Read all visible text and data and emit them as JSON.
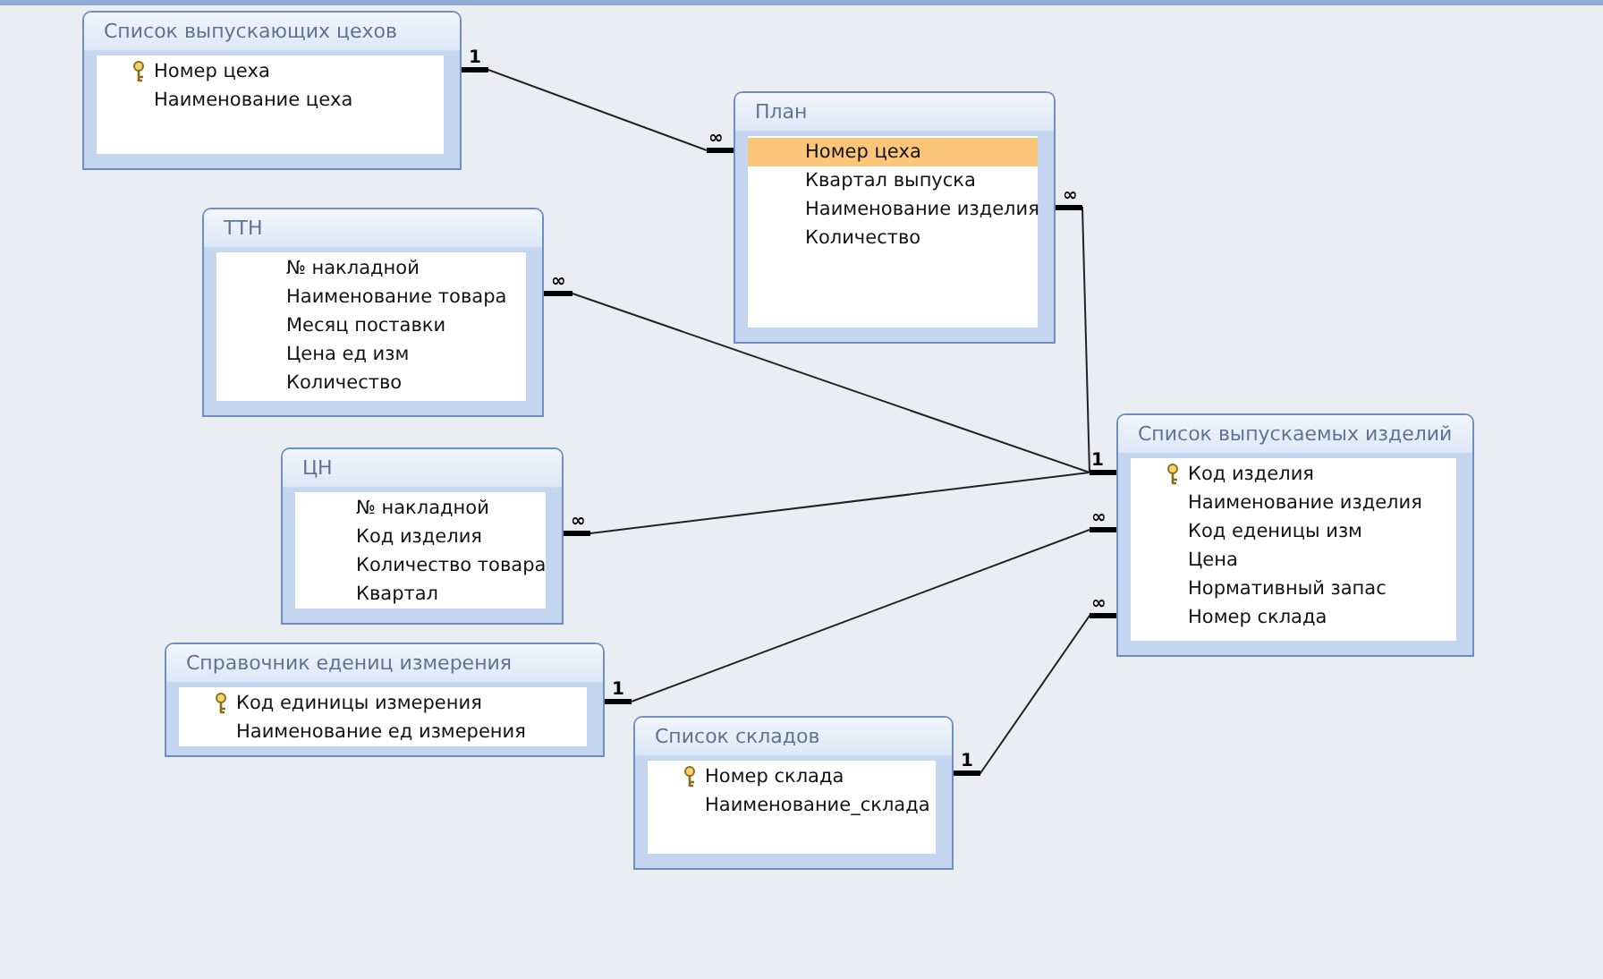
{
  "tables": [
    {
      "title": "Список выпускающих цехов",
      "fields": [
        {
          "name": "Номер цеха",
          "key": true,
          "selected": false
        },
        {
          "name": "Наименование цеха",
          "key": false,
          "selected": false
        }
      ]
    },
    {
      "title": "План",
      "fields": [
        {
          "name": "Номер цеха",
          "key": false,
          "selected": true
        },
        {
          "name": "Квартал выпуска",
          "key": false,
          "selected": false
        },
        {
          "name": "Наименование изделия",
          "key": false,
          "selected": false
        },
        {
          "name": "Количество",
          "key": false,
          "selected": false
        }
      ]
    },
    {
      "title": "ТТН",
      "fields": [
        {
          "name": "№ накладной",
          "key": false,
          "selected": false
        },
        {
          "name": "Наименование товара",
          "key": false,
          "selected": false
        },
        {
          "name": "Месяц поставки",
          "key": false,
          "selected": false
        },
        {
          "name": "Цена ед изм",
          "key": false,
          "selected": false
        },
        {
          "name": "Количество",
          "key": false,
          "selected": false
        }
      ]
    },
    {
      "title": "ЦН",
      "fields": [
        {
          "name": "№ накладной",
          "key": false,
          "selected": false
        },
        {
          "name": "Код изделия",
          "key": false,
          "selected": false
        },
        {
          "name": "Количество товара",
          "key": false,
          "selected": false
        },
        {
          "name": "Квартал",
          "key": false,
          "selected": false
        }
      ]
    },
    {
      "title": "Справочник едениц измерения",
      "fields": [
        {
          "name": "Код единицы измерения",
          "key": true,
          "selected": false
        },
        {
          "name": "Наименование ед измерения",
          "key": false,
          "selected": false
        }
      ]
    },
    {
      "title": "Список складов",
      "fields": [
        {
          "name": "Номер склада",
          "key": true,
          "selected": false
        },
        {
          "name": "Наименование_склада",
          "key": false,
          "selected": false
        }
      ]
    },
    {
      "title": "Список выпускаемых изделий",
      "fields": [
        {
          "name": "Код изделия",
          "key": true,
          "selected": false
        },
        {
          "name": "Наименование изделия",
          "key": false,
          "selected": false
        },
        {
          "name": "Код еденицы изм",
          "key": false,
          "selected": false
        },
        {
          "name": "Цена",
          "key": false,
          "selected": false
        },
        {
          "name": "Нормативный запас",
          "key": false,
          "selected": false
        },
        {
          "name": "Номер склада",
          "key": false,
          "selected": false
        }
      ]
    }
  ],
  "relationships": [
    {
      "start_label": "1",
      "end_label": "∞"
    },
    {
      "start_label": "∞",
      "end_label": "1"
    },
    {
      "start_label": "∞"
    },
    {
      "start_label": "∞"
    },
    {
      "start_label": "1",
      "end_label": "∞"
    },
    {
      "start_label": "1",
      "end_label": "∞"
    }
  ]
}
